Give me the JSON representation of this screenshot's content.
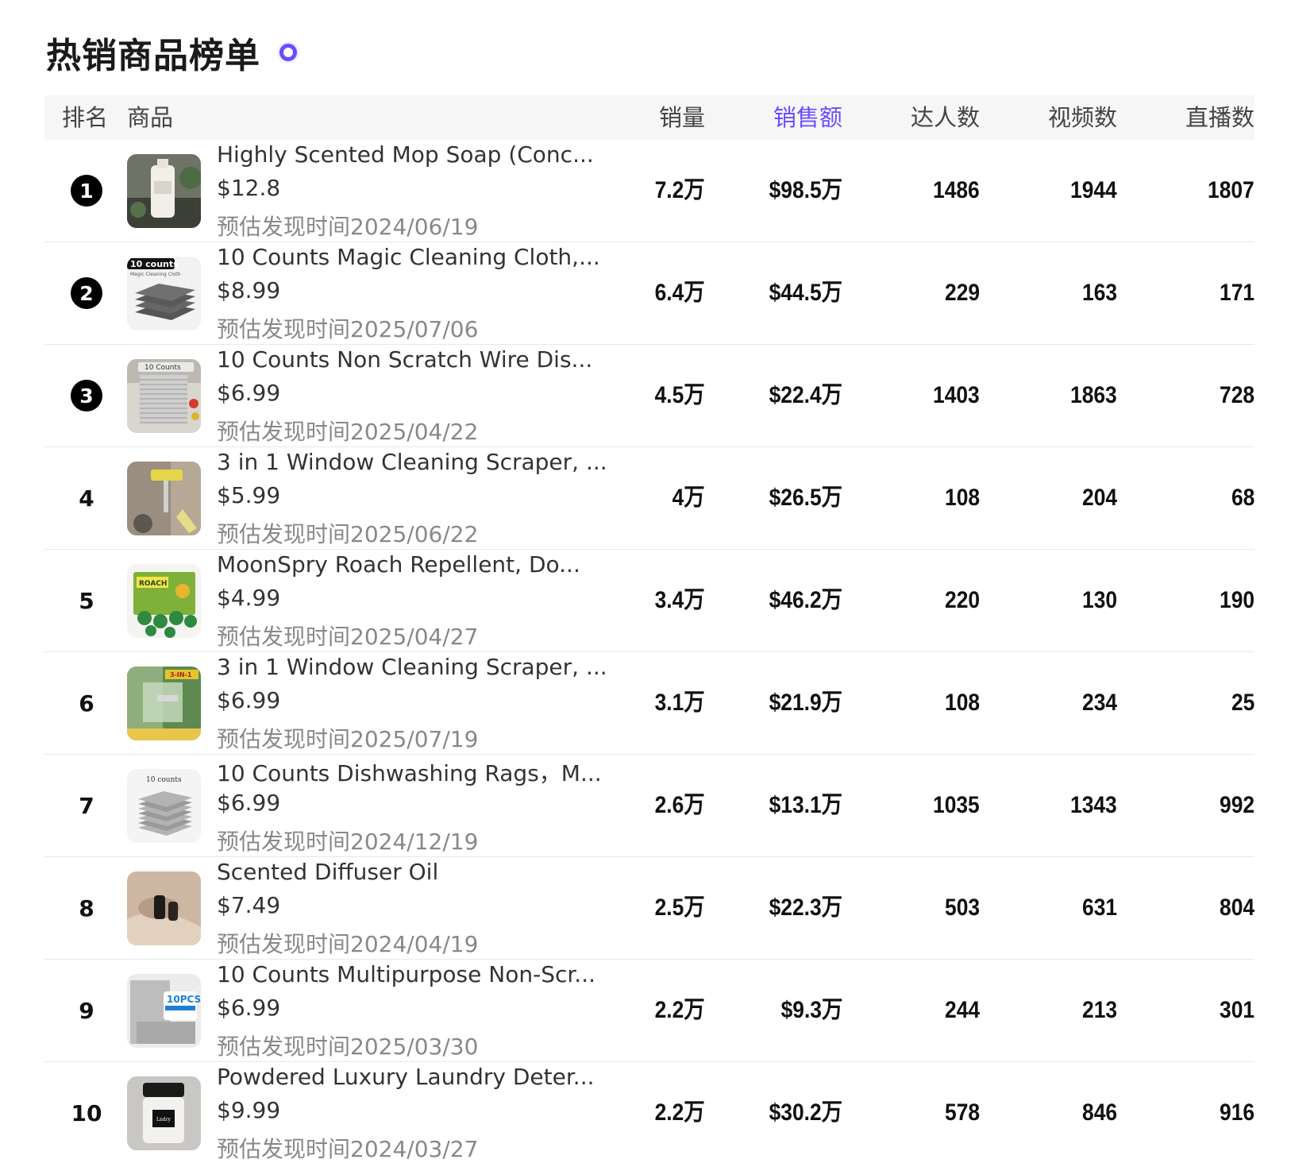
{
  "page": {
    "title": "热销商品榜单",
    "accent": "#6a4cff"
  },
  "columns": {
    "rank": "排名",
    "product": "商品",
    "sales": "销量",
    "revenue": "销售额",
    "creators": "达人数",
    "videos": "视频数",
    "live": "直播数"
  },
  "rows": [
    {
      "rank": "1",
      "name": "Highly Scented Mop Soap (Conc...",
      "price": "$12.8",
      "date": "预估发现时间2024/06/19",
      "sales": "7.2万",
      "revenue": "$98.5万",
      "creators": "1486",
      "videos": "1944",
      "live": "1807",
      "thumb": "mop-soap-bottle-image"
    },
    {
      "rank": "2",
      "name": "10 Counts Magic Cleaning Cloth,...",
      "price": "$8.99",
      "date": "预估发现时间2025/07/06",
      "sales": "6.4万",
      "revenue": "$44.5万",
      "creators": "229",
      "videos": "163",
      "live": "171",
      "thumb": "cleaning-cloth-stack-image",
      "thumb_text": "10 counts"
    },
    {
      "rank": "3",
      "name": "10 Counts Non Scratch Wire Dis...",
      "price": "$6.99",
      "date": "预估发现时间2025/04/22",
      "sales": "4.5万",
      "revenue": "$22.4万",
      "creators": "1403",
      "videos": "1863",
      "live": "728",
      "thumb": "wire-dishcloth-image",
      "thumb_text": "10 Counts"
    },
    {
      "rank": "4",
      "name": "3 in 1 Window Cleaning Scraper, ...",
      "price": "$5.99",
      "date": "预估发现时间2025/06/22",
      "sales": "4万",
      "revenue": "$26.5万",
      "creators": "108",
      "videos": "204",
      "live": "68",
      "thumb": "window-scraper-image"
    },
    {
      "rank": "5",
      "name": "MoonSpry Roach Repellent, Do...",
      "price": "$4.99",
      "date": "预估发现时间2025/04/27",
      "sales": "3.4万",
      "revenue": "$46.2万",
      "creators": "220",
      "videos": "130",
      "live": "190",
      "thumb": "roach-repellent-image",
      "thumb_text": "ROACH"
    },
    {
      "rank": "6",
      "name": "3 in 1 Window Cleaning Scraper, ...",
      "price": "$6.99",
      "date": "预估发现时间2025/07/19",
      "sales": "3.1万",
      "revenue": "$21.9万",
      "creators": "108",
      "videos": "234",
      "live": "25",
      "thumb": "window-scraper-green-image",
      "thumb_text": "3-IN-1"
    },
    {
      "rank": "7",
      "name": "10 Counts Dishwashing Rags，M...",
      "price": "$6.99",
      "date": "预估发现时间2024/12/19",
      "sales": "2.6万",
      "revenue": "$13.1万",
      "creators": "1035",
      "videos": "1343",
      "live": "992",
      "thumb": "dishwashing-rags-image",
      "thumb_text": "10 counts"
    },
    {
      "rank": "8",
      "name": "Scented Diffuser Oil",
      "price": "$7.49",
      "date": "预估发现时间2024/04/19",
      "sales": "2.5万",
      "revenue": "$22.3万",
      "creators": "503",
      "videos": "631",
      "live": "804",
      "thumb": "diffuser-oil-image"
    },
    {
      "rank": "9",
      "name": "10 Counts Multipurpose Non-Scr...",
      "price": "$6.99",
      "date": "预估发现时间2025/03/30",
      "sales": "2.2万",
      "revenue": "$9.3万",
      "creators": "244",
      "videos": "213",
      "live": "301",
      "thumb": "multipurpose-cloth-image",
      "thumb_text": "10PCS"
    },
    {
      "rank": "10",
      "name": "Powdered Luxury Laundry Deter...",
      "price": "$9.99",
      "date": "预估发现时间2024/03/27",
      "sales": "2.2万",
      "revenue": "$30.2万",
      "creators": "578",
      "videos": "846",
      "live": "916",
      "thumb": "laundry-candle-jar-image"
    }
  ]
}
